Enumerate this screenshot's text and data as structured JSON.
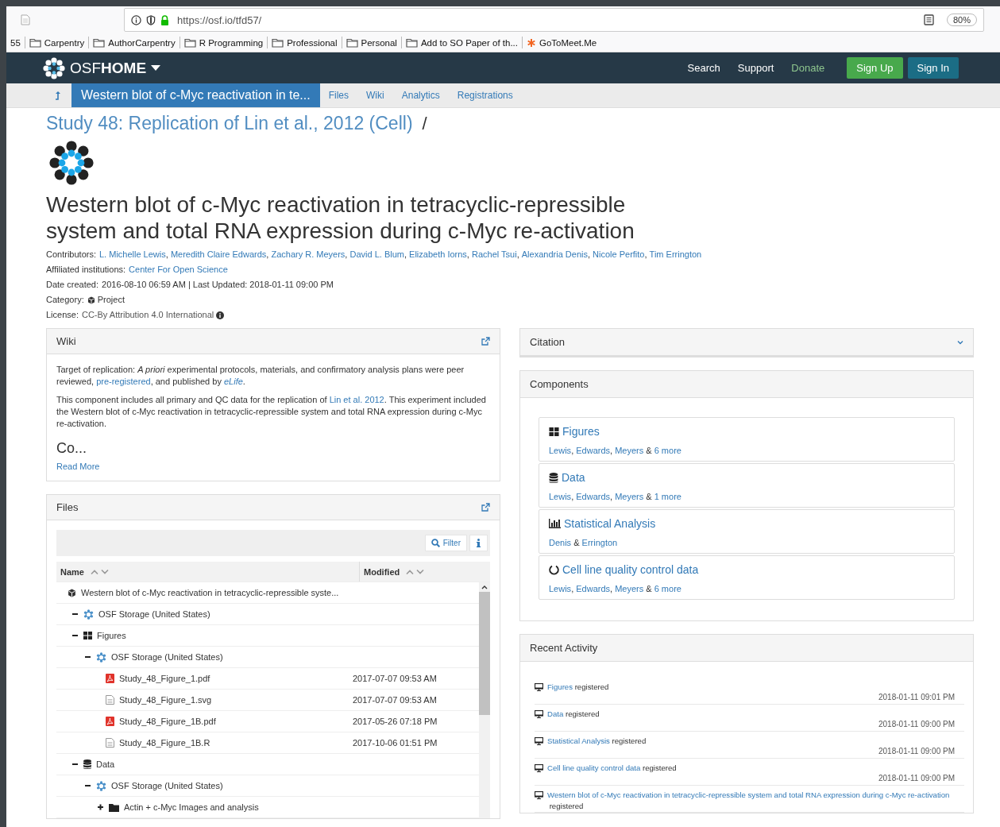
{
  "browser": {
    "url": "https://osf.io/tfd57/",
    "zoom": "80%",
    "bookmarks": [
      {
        "label": "55",
        "kind": "text"
      },
      {
        "label": "Carpentry",
        "kind": "folder"
      },
      {
        "label": "AuthorCarpentry",
        "kind": "folder"
      },
      {
        "label": "R Programming",
        "kind": "folder"
      },
      {
        "label": "Professional",
        "kind": "folder"
      },
      {
        "label": "Personal",
        "kind": "folder"
      },
      {
        "label": "Add to SO Paper of th...",
        "kind": "folder"
      },
      {
        "label": "GoToMeet.Me",
        "kind": "site"
      }
    ]
  },
  "navbar": {
    "brand": "OSF**HOME**",
    "links": [
      {
        "label": "Search",
        "kind": "plain"
      },
      {
        "label": "Support",
        "kind": "plain"
      },
      {
        "label": "Donate",
        "kind": "donate"
      }
    ],
    "buttons": [
      {
        "label": "Sign Up",
        "kind": "primary"
      },
      {
        "label": "Sign In",
        "kind": "info"
      }
    ]
  },
  "subnav": {
    "tabs": [
      {
        "label": "Western blot of c-Myc reactivation in te...",
        "selected": true
      },
      {
        "label": "Files",
        "selected": false
      },
      {
        "label": "Wiki",
        "selected": false
      },
      {
        "label": "Analytics",
        "selected": false
      },
      {
        "label": "Registrations",
        "selected": false
      }
    ]
  },
  "breadcrumb": {
    "parent": "Study 48: Replication of Lin et al., 2012 (Cell)",
    "separator": "/"
  },
  "title": "Western blot of c-Myc reactivation in tetracyclic-repressible system and total RNA expression during c-Myc re-activation",
  "meta": [
    {
      "label": "Contributors:",
      "segments": [
        {
          "text": "L. Michelle Lewis",
          "kind": "link"
        },
        {
          "text": ", ",
          "kind": "text"
        },
        {
          "text": "Meredith Claire Edwards",
          "kind": "link"
        },
        {
          "text": ", ",
          "kind": "text"
        },
        {
          "text": "Zachary R. Meyers",
          "kind": "link"
        },
        {
          "text": ", ",
          "kind": "text"
        },
        {
          "text": "David L. Blum",
          "kind": "link"
        },
        {
          "text": ", ",
          "kind": "text"
        },
        {
          "text": "Elizabeth Iorns",
          "kind": "link"
        },
        {
          "text": ", ",
          "kind": "text"
        },
        {
          "text": "Rachel Tsui",
          "kind": "link"
        },
        {
          "text": ", ",
          "kind": "text"
        },
        {
          "text": "Alexandria Denis",
          "kind": "link"
        },
        {
          "text": ", ",
          "kind": "text"
        },
        {
          "text": "Nicole Perfito",
          "kind": "link"
        },
        {
          "text": ", ",
          "kind": "text"
        },
        {
          "text": "Tim Errington",
          "kind": "link"
        }
      ]
    },
    {
      "label": "Affiliated institutions:",
      "segments": [
        {
          "text": "Center For Open Science",
          "kind": "link"
        }
      ]
    },
    {
      "label": "Date created:",
      "segments": [
        {
          "text": "2016-08-10 06:59 AM | Last Updated: 2018-01-11 09:00 PM",
          "kind": "text"
        }
      ]
    },
    {
      "label": "Category:",
      "kind": "category",
      "segments": [
        {
          "text": "Project",
          "kind": "text"
        }
      ]
    },
    {
      "label": "License:",
      "kind": "license",
      "segments": [
        {
          "text": "CC-By Attribution 4.0 International",
          "kind": "muted"
        }
      ]
    }
  ],
  "wiki": {
    "title": "Wiki",
    "paragraphs": [
      [
        {
          "text": "Target of replication: ",
          "kind": "text"
        },
        {
          "text": "A priori",
          "kind": "italic"
        },
        {
          "text": " experimental protocols, materials, and confirmatory analysis plans were peer reviewed, ",
          "kind": "text"
        },
        {
          "text": "pre-registered",
          "kind": "link"
        },
        {
          "text": ", and published by ",
          "kind": "text"
        },
        {
          "text": "eLife",
          "kind": "italic-link"
        },
        {
          "text": ".",
          "kind": "text"
        }
      ],
      [
        {
          "text": "This component includes all primary and QC data for the replication of ",
          "kind": "text"
        },
        {
          "text": "Lin et al. 2012",
          "kind": "link"
        },
        {
          "text": ". This experiment included the Western blot of c-Myc reactivation in tetracyclic-repressible system and total RNA expression during c-Myc re-activation.",
          "kind": "text"
        }
      ]
    ],
    "heading": "Co...",
    "read_more": "Read More"
  },
  "files": {
    "title": "Files",
    "filter": "Filter",
    "columns": [
      "Name",
      "Modified"
    ],
    "tree": [
      {
        "name": "Western blot of c-Myc reactivation in tetracyclic-repressible syste...",
        "kind": "project",
        "children": [
          {
            "name": "OSF Storage (United States)",
            "kind": "storage",
            "expanded": true
          },
          {
            "name": "Figures",
            "kind": "component",
            "expanded": true,
            "children": [
              {
                "name": "OSF Storage (United States)",
                "kind": "storage",
                "expanded": true,
                "children": [
                  {
                    "name": "Study_48_Figure_1.pdf",
                    "kind": "pdf",
                    "modified": "2017-07-07 09:53 AM"
                  },
                  {
                    "name": "Study_48_Figure_1.svg",
                    "kind": "file",
                    "modified": "2017-07-07 09:53 AM"
                  },
                  {
                    "name": "Study_48_Figure_1B.pdf",
                    "kind": "pdf",
                    "modified": "2017-05-26 07:18 PM"
                  },
                  {
                    "name": "Study_48_Figure_1B.R",
                    "kind": "file",
                    "modified": "2017-10-06 01:51 PM"
                  }
                ]
              }
            ]
          },
          {
            "name": "Data",
            "kind": "database",
            "expanded": true,
            "children": [
              {
                "name": "OSF Storage (United States)",
                "kind": "storage",
                "expanded": true,
                "children": [
                  {
                    "name": "Actin + c-Myc Images and analysis",
                    "kind": "folder",
                    "expanded": false
                  }
                ]
              }
            ]
          }
        ]
      }
    ]
  },
  "citation": {
    "title": "Citation",
    "expanded": false
  },
  "components": {
    "title": "Components",
    "items": [
      {
        "title": "Figures",
        "kind": "grid",
        "authors": [
          {
            "text": "Lewis",
            "kind": "link"
          },
          {
            "text": ", ",
            "kind": "text"
          },
          {
            "text": "Edwards",
            "kind": "link"
          },
          {
            "text": ", ",
            "kind": "text"
          },
          {
            "text": "Meyers",
            "kind": "link"
          },
          {
            "text": " & ",
            "kind": "text"
          },
          {
            "text": "6 more",
            "kind": "link"
          }
        ]
      },
      {
        "title": "Data",
        "kind": "database",
        "authors": [
          {
            "text": "Lewis",
            "kind": "link"
          },
          {
            "text": ", ",
            "kind": "text"
          },
          {
            "text": "Edwards",
            "kind": "link"
          },
          {
            "text": ", ",
            "kind": "text"
          },
          {
            "text": "Meyers",
            "kind": "link"
          },
          {
            "text": " & ",
            "kind": "text"
          },
          {
            "text": "1 more",
            "kind": "link"
          }
        ]
      },
      {
        "title": "Statistical Analysis",
        "kind": "chart",
        "authors": [
          {
            "text": "Denis",
            "kind": "link"
          },
          {
            "text": " & ",
            "kind": "text"
          },
          {
            "text": "Errington",
            "kind": "link"
          }
        ]
      },
      {
        "title": "Cell line quality control data",
        "kind": "ring",
        "authors": [
          {
            "text": "Lewis",
            "kind": "link"
          },
          {
            "text": ", ",
            "kind": "text"
          },
          {
            "text": "Edwards",
            "kind": "link"
          },
          {
            "text": ", ",
            "kind": "text"
          },
          {
            "text": "Meyers",
            "kind": "link"
          },
          {
            "text": " & ",
            "kind": "text"
          },
          {
            "text": "6 more",
            "kind": "link"
          }
        ]
      }
    ]
  },
  "activity": {
    "title": "Recent Activity",
    "items": [
      {
        "segments": [
          {
            "text": "Figures",
            "kind": "link"
          },
          {
            "text": " registered",
            "kind": "text"
          }
        ],
        "time": "2018-01-11 09:01 PM"
      },
      {
        "segments": [
          {
            "text": "Data",
            "kind": "link"
          },
          {
            "text": " registered",
            "kind": "text"
          }
        ],
        "time": "2018-01-11 09:00 PM"
      },
      {
        "segments": [
          {
            "text": "Statistical Analysis",
            "kind": "link"
          },
          {
            "text": " registered",
            "kind": "text"
          }
        ],
        "time": "2018-01-11 09:00 PM"
      },
      {
        "segments": [
          {
            "text": "Cell line quality control data",
            "kind": "link"
          },
          {
            "text": " registered",
            "kind": "text"
          }
        ],
        "time": "2018-01-11 09:00 PM"
      },
      {
        "segments": [
          {
            "text": "Western blot of c-Myc reactivation in tetracyclic-repressible system and total RNA expression during c-Myc re-",
            "kind": "link"
          },
          {
            "text": "activation",
            "kind": "link"
          },
          {
            "text": " registered",
            "kind": "text"
          }
        ]
      }
    ]
  }
}
